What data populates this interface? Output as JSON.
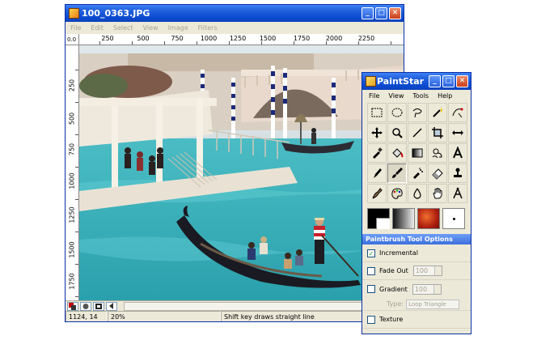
{
  "main_window": {
    "title": "100_0363.JPG",
    "menu": [
      "File",
      "Edit",
      "Select",
      "View",
      "Image",
      "Filters"
    ],
    "ruler_corner": "0.0",
    "h_ruler_labels": [
      "250",
      "500",
      "750",
      "1000",
      "1250",
      "1500",
      "1750",
      "2000",
      "2250"
    ],
    "v_ruler_labels": [
      "250",
      "500",
      "750",
      "1000",
      "1250",
      "1500",
      "1750"
    ],
    "status": {
      "coordinates": "1124, 14",
      "zoom": "20%",
      "hint": "Shift key draws straight line"
    }
  },
  "tools_window": {
    "title": "PaintStar",
    "menu": [
      "File",
      "View",
      "Tools",
      "Help"
    ],
    "tools": [
      "rect-select-icon",
      "ellipse-select-icon",
      "lasso-icon",
      "magic-wand-icon",
      "bezier-icon",
      "move-icon",
      "zoom-icon",
      "line-icon",
      "crop-icon",
      "resize-icon",
      "eyedropper-icon",
      "paint-bucket-icon",
      "gradient-icon",
      "clone-icon",
      "text-icon",
      "pencil-icon",
      "paintbrush-icon",
      "airbrush-icon",
      "eraser-icon",
      "stamp-icon",
      "smudge-icon",
      "palette-icon",
      "drop-icon",
      "hand-icon",
      "compass-icon"
    ],
    "active_tool": "paintbrush-icon",
    "options": {
      "title": "Paintbrush Tool Options",
      "incremental_label": "Incremental",
      "incremental_checked": true,
      "fade_out_label": "Fade Out",
      "fade_out_value": "100",
      "gradient_label": "Gradient",
      "gradient_value": "100",
      "type_label": "Type:",
      "type_value": "Loop Triangle",
      "texture_label": "Texture"
    }
  },
  "colors": {
    "titlebar": "#0a4ad0",
    "window_bg": "#ece9d8",
    "water": "#3fb7c0",
    "gondola": "#1a1a22"
  }
}
